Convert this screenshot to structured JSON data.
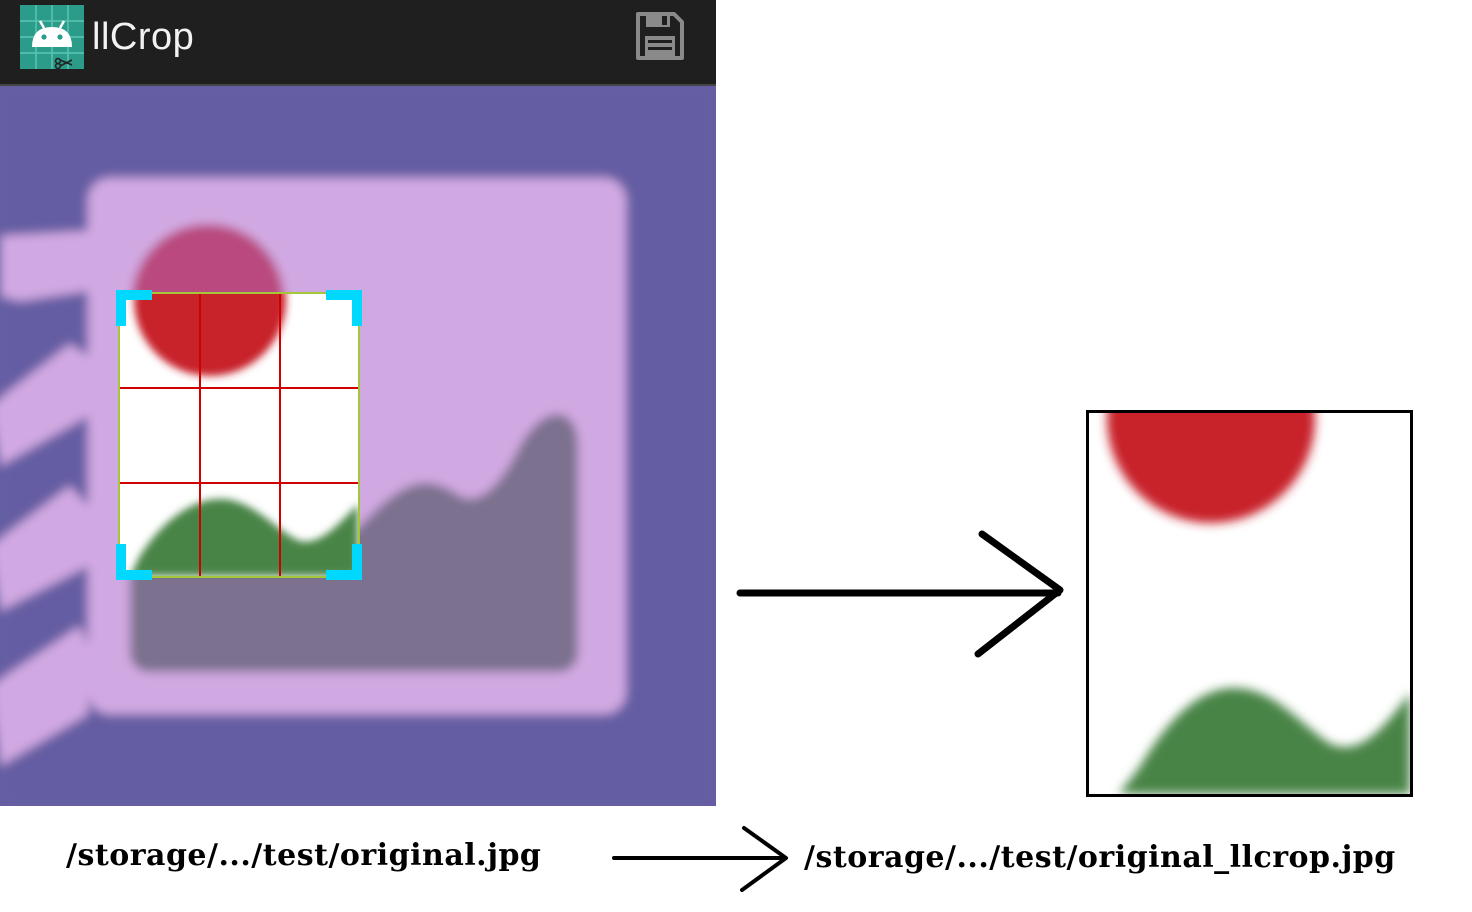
{
  "app": {
    "title": "llCrop",
    "icon": "app-launcher-icon",
    "actions": [
      {
        "name": "save",
        "icon": "save-icon"
      }
    ]
  },
  "crop": {
    "grid": "3x3",
    "handles": [
      "top-left",
      "top-right",
      "bottom-left",
      "bottom-right"
    ],
    "handle_color": "#00d8ff",
    "grid_color": "#d00000",
    "border_color": "#a4c639"
  },
  "colors": {
    "toolbar": "#1f1f1f",
    "canvas_background": "#655da3",
    "image_frame": "#d1a9e2",
    "sun": "#c8242b",
    "hill": "#4a8447",
    "mountain": "#7c718e"
  },
  "files": {
    "source_path": "/storage/.../test/original.jpg",
    "output_path": "/storage/.../test/original_llcrop.jpg"
  }
}
